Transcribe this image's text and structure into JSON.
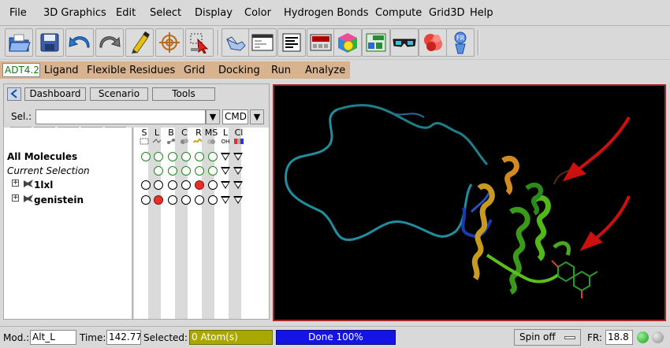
{
  "menu": [
    "File",
    "3D Graphics",
    "Edit",
    "Select",
    "Display",
    "Color",
    "Hydrogen Bonds",
    "Compute",
    "Grid3D",
    "Help"
  ],
  "toolbar_icons": [
    "open-folder-icon",
    "save-disk-icon",
    "undo-arrow-icon",
    "redo-arrow-icon",
    "pencil-icon",
    "crosshair-icon",
    "select-pointer-icon",
    "hand-pointer-icon",
    "python-shell-icon",
    "text-lines-icon",
    "dashboard-panel-icon",
    "color-cube-icon",
    "grid-panel-icon",
    "stereo-glasses-icon",
    "molecular-surface-icon",
    "fr-figure-icon"
  ],
  "adt": {
    "logo": "ADT4.2",
    "menu": [
      "Ligand",
      "Flexible Residues",
      "Grid",
      "Docking",
      "Run",
      "Analyze"
    ]
  },
  "dashboard": {
    "tabs": [
      "Dashboard",
      "Scenario",
      "Tools"
    ],
    "sel_label": "Sel.:",
    "sel_value": "",
    "cmd_label": "CMD",
    "column_headers": [
      "S",
      "L",
      "B",
      "C",
      "R",
      "MS",
      "L",
      "Cl"
    ],
    "column_sub": [
      "",
      "",
      "",
      "",
      "",
      "",
      "OH",
      ""
    ],
    "rows": [
      {
        "label": "All Molecules",
        "style": "bold",
        "expander": false,
        "circles": [
          "g",
          "g",
          "g",
          "g",
          "g",
          "g"
        ],
        "triangles": 2
      },
      {
        "label": "Current Selection",
        "style": "italic",
        "expander": false,
        "circles": [
          "",
          "g",
          "g",
          "g",
          "g",
          "g"
        ],
        "triangles": 2
      },
      {
        "label": "1lxl",
        "style": "bold",
        "expander": true,
        "circles": [
          "w",
          "w",
          "w",
          "w",
          "r",
          "w"
        ],
        "triangles": 2
      },
      {
        "label": "genistein",
        "style": "bold",
        "expander": true,
        "circles": [
          "w",
          "r",
          "w",
          "w",
          "w",
          "w"
        ],
        "triangles": 2
      }
    ]
  },
  "status": {
    "mod_label": "Mod.:",
    "mod_value": "Alt_L",
    "time_label": "Time:",
    "time_value": "142.770",
    "selected_label": "Selected:",
    "selected_value": "0 Atom(s)",
    "progress_label": "Done 100%",
    "progress_percent": 100,
    "spin_label": "Spin off",
    "fr_label": "FR:",
    "fr_value": "18.8"
  },
  "colors": {
    "adt_bar": "#d8b38f",
    "viewer_border": "#a52828",
    "selected_bg": "#a8a800",
    "progress_bg": "#1414e6",
    "arrow": "#cc1010"
  }
}
